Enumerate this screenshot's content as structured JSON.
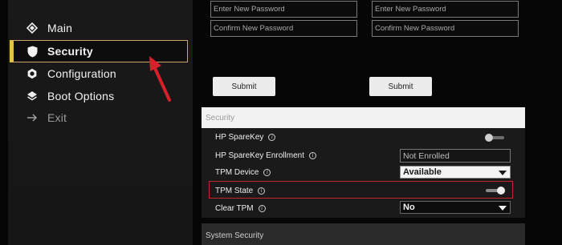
{
  "nav": {
    "items": [
      {
        "label": "Main",
        "icon": "diamond-icon"
      },
      {
        "label": "Security",
        "icon": "shield-icon"
      },
      {
        "label": "Configuration",
        "icon": "gear-icon"
      },
      {
        "label": "Boot Options",
        "icon": "layers-icon"
      },
      {
        "label": "Exit",
        "icon": "arrow-right-icon"
      }
    ],
    "active": "Security"
  },
  "password": {
    "left_new_placeholder": "Enter New Password",
    "left_confirm_placeholder": "Confirm New Password",
    "right_new_placeholder": "Enter New Password",
    "right_confirm_placeholder": "Confirm New Password",
    "submit_left": "Submit",
    "submit_right": "Submit"
  },
  "security": {
    "header": "Security",
    "rows": {
      "sparekey": {
        "label": "HP SpareKey",
        "toggle_on": false
      },
      "enrollment": {
        "label": "HP SpareKey Enrollment",
        "value": "Not Enrolled"
      },
      "tpm_device": {
        "label": "TPM Device",
        "value": "Available"
      },
      "tpm_state": {
        "label": "TPM State",
        "toggle_on": true
      },
      "clear_tpm": {
        "label": "Clear TPM",
        "value": "No"
      }
    },
    "info_glyph": "i"
  },
  "system_security": {
    "header": "System Security"
  },
  "colors": {
    "highlight_red": "#c0262c",
    "active_border": "#c9a36a",
    "annotation_arrow": "#d6202a"
  }
}
